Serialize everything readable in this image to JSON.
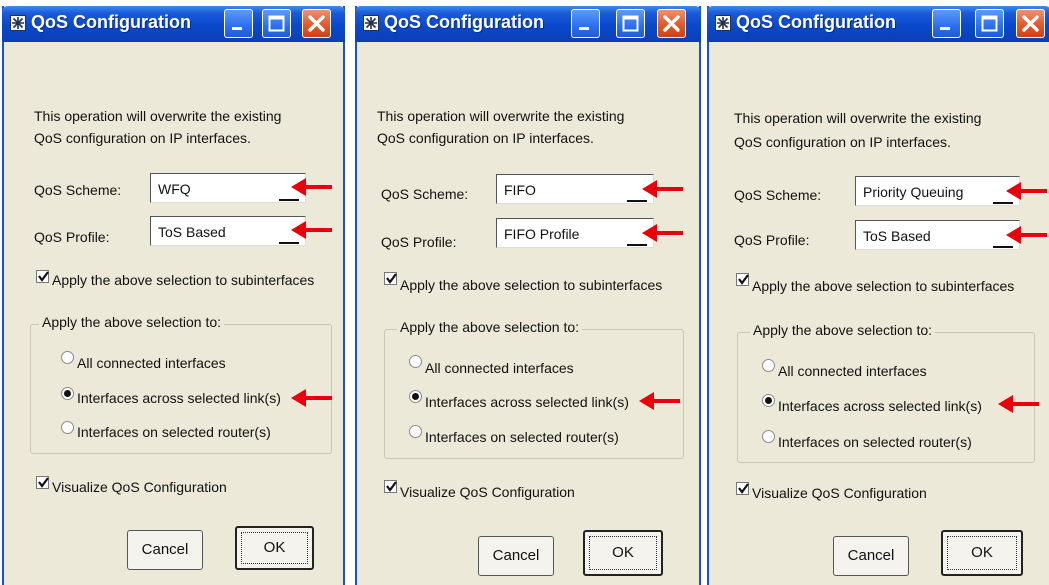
{
  "colors": {
    "accent": "#1c4fd6",
    "arrow": "#e8000b",
    "close": "#e05a2a"
  },
  "dialogs": [
    {
      "title": "QoS Configuration",
      "intro_line1": "This operation will overwrite the existing",
      "intro_line2": "QoS configuration on IP interfaces.",
      "scheme_label": "QoS Scheme:",
      "scheme_value": "WFQ",
      "profile_label": "QoS Profile:",
      "profile_value": "ToS Based",
      "subinterfaces_label": "Apply the above selection to subinterfaces",
      "group_label": "Apply the above selection to:",
      "radio_all": "All connected interfaces",
      "radio_links": "Interfaces across selected link(s)",
      "radio_routers": "Interfaces on selected router(s)",
      "visualize_label": "Visualize QoS Configuration",
      "cancel_label": "Cancel",
      "ok_label": "OK"
    },
    {
      "title": "QoS Configuration",
      "intro_line1": "This operation will overwrite the existing",
      "intro_line2": "QoS configuration on IP interfaces.",
      "scheme_label": "QoS Scheme:",
      "scheme_value": "FIFO",
      "profile_label": "QoS Profile:",
      "profile_value": "FIFO Profile",
      "subinterfaces_label": "Apply the above selection to subinterfaces",
      "group_label": "Apply the above selection to:",
      "radio_all": "All connected interfaces",
      "radio_links": "Interfaces across selected link(s)",
      "radio_routers": "Interfaces on selected router(s)",
      "visualize_label": "Visualize QoS Configuration",
      "cancel_label": "Cancel",
      "ok_label": "OK"
    },
    {
      "title": "QoS Configuration",
      "intro_line1": "This operation will overwrite the existing",
      "intro_line2": "QoS configuration on IP interfaces.",
      "scheme_label": "QoS Scheme:",
      "scheme_value": "Priority Queuing",
      "profile_label": "QoS Profile:",
      "profile_value": "ToS Based",
      "subinterfaces_label": "Apply the above selection to subinterfaces",
      "group_label": "Apply the above selection to:",
      "radio_all": "All connected interfaces",
      "radio_links": "Interfaces across selected link(s)",
      "radio_routers": "Interfaces on selected router(s)",
      "visualize_label": "Visualize QoS Configuration",
      "cancel_label": "Cancel",
      "ok_label": "OK"
    }
  ]
}
